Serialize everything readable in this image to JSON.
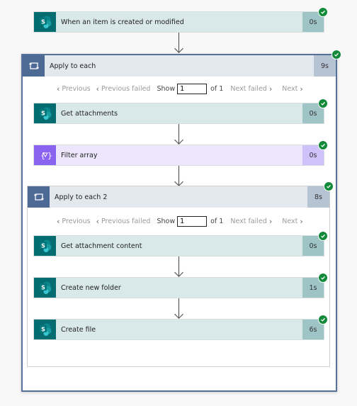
{
  "trigger": {
    "title": "When an item is created or modified",
    "duration": "0s",
    "icon": "sharepoint-icon",
    "status": "succeeded"
  },
  "apply_to_each": {
    "title": "Apply to each",
    "duration": "9s",
    "icon": "loop-icon",
    "status": "succeeded",
    "pager": {
      "previous": "Previous",
      "previous_failed": "Previous failed",
      "show": "Show",
      "current": "1",
      "of": "of 1",
      "next_failed": "Next failed",
      "next": "Next"
    },
    "actions": [
      {
        "title": "Get attachments",
        "duration": "0s",
        "icon": "sharepoint-icon",
        "status": "succeeded"
      },
      {
        "title": "Filter array",
        "duration": "0s",
        "icon": "filter-array-icon",
        "status": "succeeded"
      }
    ],
    "apply_to_each_2": {
      "title": "Apply to each 2",
      "duration": "8s",
      "icon": "loop-icon",
      "status": "succeeded",
      "pager": {
        "previous": "Previous",
        "previous_failed": "Previous failed",
        "show": "Show",
        "current": "1",
        "of": "of 1",
        "next_failed": "Next failed",
        "next": "Next"
      },
      "actions": [
        {
          "title": "Get attachment content",
          "duration": "0s",
          "icon": "sharepoint-icon",
          "status": "succeeded"
        },
        {
          "title": "Create new folder",
          "duration": "1s",
          "icon": "sharepoint-icon",
          "status": "succeeded"
        },
        {
          "title": "Create file",
          "duration": "6s",
          "icon": "sharepoint-icon",
          "status": "succeeded"
        }
      ]
    }
  },
  "colors": {
    "sharepoint": "#036c70",
    "filter": "#8a63f0",
    "loop": "#4d6a95",
    "success": "#128a3a"
  }
}
